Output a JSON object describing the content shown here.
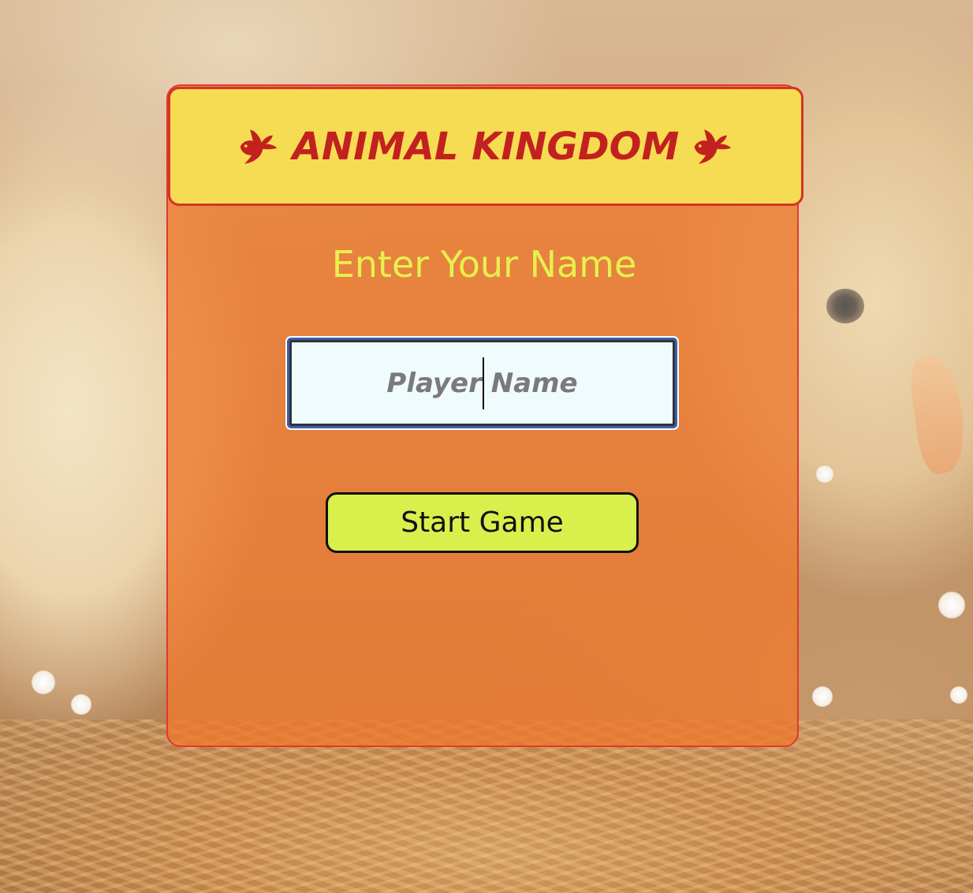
{
  "header": {
    "title": "ANIMAL KINGDOM",
    "left_icon": "dove-icon",
    "right_icon": "dove-icon"
  },
  "form": {
    "prompt": "Enter Your Name",
    "name_input": {
      "value": "",
      "placeholder": "Player Name"
    },
    "start_button_label": "Start Game"
  },
  "colors": {
    "header_bg": "#f5dc52",
    "header_border": "#d4332a",
    "title_text": "#c32020",
    "panel_bg": "#ee782d",
    "prompt_text": "#e7f04d",
    "button_bg": "#d9ef4c",
    "input_bg": "#effbfd",
    "input_border": "#3a5fb0"
  }
}
